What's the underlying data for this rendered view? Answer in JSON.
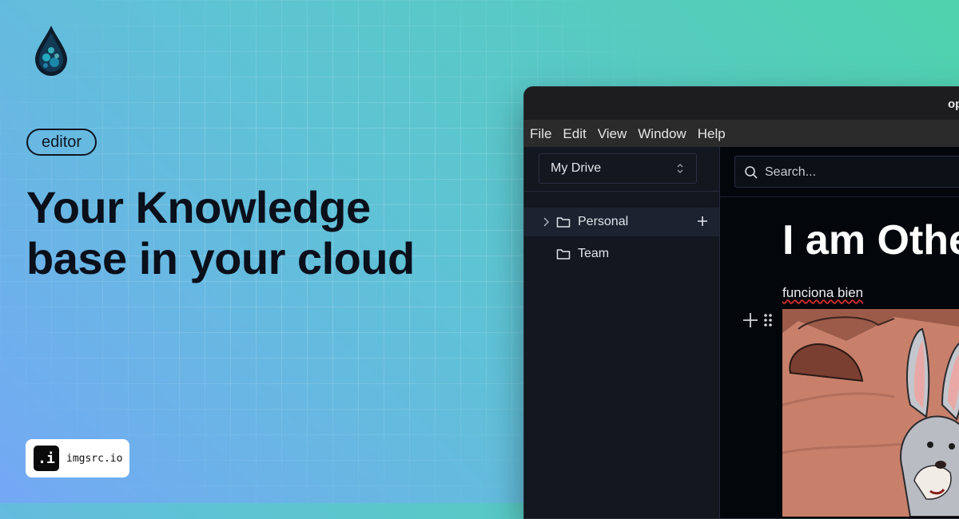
{
  "brand": {
    "logo_icon": "droplet-logo-icon"
  },
  "hero": {
    "tag": "editor",
    "headline_line1": "Your Knowledge",
    "headline_line2": "base in your cloud"
  },
  "badge": {
    "icon_glyph": ".i",
    "text": "imgsrc.io"
  },
  "window": {
    "title": "op",
    "menu": [
      "File",
      "Edit",
      "View",
      "Window",
      "Help"
    ],
    "sidebar": {
      "drive_selector": "My Drive",
      "items": [
        {
          "label": "Personal",
          "icon": "folder-icon",
          "expanded": false,
          "active": true
        },
        {
          "label": "Team",
          "icon": "folder-icon",
          "active": false
        }
      ]
    },
    "search": {
      "placeholder": "Search..."
    },
    "document": {
      "title": "I am Othe",
      "paragraph": "funciona bien",
      "image_alt": "bugs-bunny-image"
    }
  },
  "colors": {
    "gradient_start": "#74a8f5",
    "gradient_end": "#4fd3ad",
    "window_bg": "#0d1117",
    "sidebar_bg": "#121720",
    "main_bg": "#03060b"
  }
}
